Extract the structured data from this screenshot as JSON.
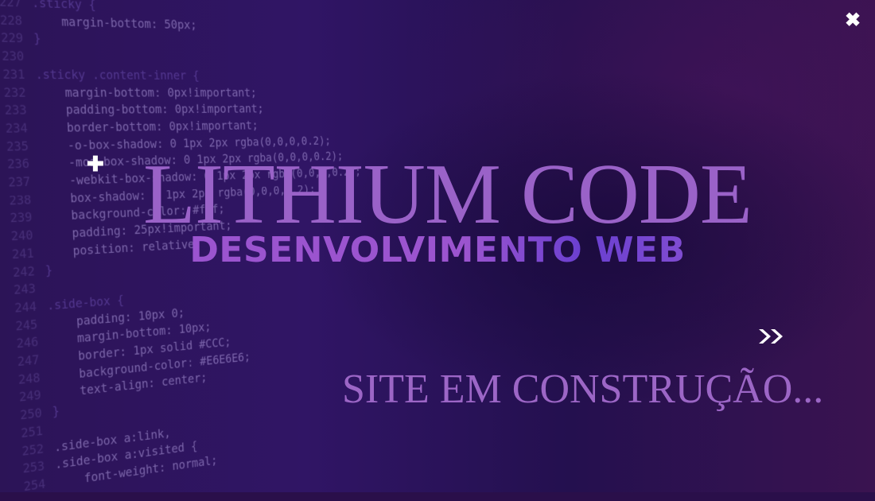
{
  "window": {
    "close_icon": "close-x-icon"
  },
  "code_background": [
    {
      "num": "227",
      "text": ".sticky {"
    },
    {
      "num": "228",
      "text": "    margin-bottom: 50px;"
    },
    {
      "num": "229",
      "text": "}"
    },
    {
      "num": "230",
      "text": ""
    },
    {
      "num": "231",
      "text": ".sticky .content-inner {"
    },
    {
      "num": "232",
      "text": "    margin-bottom: 0px!important;"
    },
    {
      "num": "233",
      "text": "    padding-bottom: 0px!important;"
    },
    {
      "num": "234",
      "text": "    border-bottom: 0px!important;"
    },
    {
      "num": "235",
      "text": "    -o-box-shadow: 0 1px 2px rgba(0,0,0,0.2);"
    },
    {
      "num": "236",
      "text": "    -moz-box-shadow: 0 1px 2px rgba(0,0,0,0.2);"
    },
    {
      "num": "237",
      "text": "    -webkit-box-shadow: 0 1px 2px rgba(0,0,0,0.2);"
    },
    {
      "num": "238",
      "text": "    box-shadow: 0 1px 2px rgba(0,0,0,0.2);"
    },
    {
      "num": "239",
      "text": "    background-color: #fff;"
    },
    {
      "num": "240",
      "text": "    padding: 25px!important;"
    },
    {
      "num": "241",
      "text": "    position: relative;"
    },
    {
      "num": "242",
      "text": "}"
    },
    {
      "num": "243",
      "text": ""
    },
    {
      "num": "244",
      "text": ".side-box {"
    },
    {
      "num": "245",
      "text": "    padding: 10px 0;"
    },
    {
      "num": "246",
      "text": "    margin-bottom: 10px;"
    },
    {
      "num": "247",
      "text": "    border: 1px solid #CCC;"
    },
    {
      "num": "248",
      "text": "    background-color: #E6E6E6;"
    },
    {
      "num": "249",
      "text": "    text-align: center;"
    },
    {
      "num": "250",
      "text": "}"
    },
    {
      "num": "251",
      "text": ""
    },
    {
      "num": "252",
      "text": ".side-box a:link,"
    },
    {
      "num": "253",
      "text": ".side-box a:visited {"
    },
    {
      "num": "254",
      "text": "    font-weight: normal;"
    }
  ],
  "hero": {
    "title": "LITHIUM CODE",
    "subtitle": "DESENVOLVIMENTO WEB",
    "plus_icon": "plus-icon",
    "next_icon": "double-chevron-right-icon",
    "status": "SITE EM CONSTRUÇÃO..."
  },
  "colors": {
    "title": "#9a62c8",
    "subtitle": "#9b54cf",
    "status": "#9c66c6",
    "background": "#2a0f4a"
  }
}
